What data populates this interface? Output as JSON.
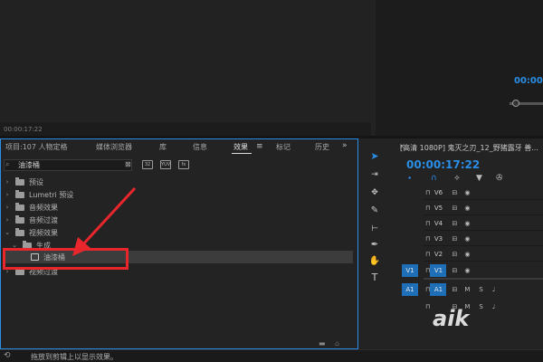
{
  "program_monitor": {
    "timecode": "00:00:17:22",
    "icons": [
      "export-frame-icon",
      "settings-icon"
    ]
  },
  "source_monitor": {
    "timecode": "00:00:"
  },
  "effects_panel": {
    "tabs": [
      {
        "label": "项目:107 人物定格",
        "active": false
      },
      {
        "label": "媒体浏览器",
        "active": false
      },
      {
        "label": "库",
        "active": false
      },
      {
        "label": "信息",
        "active": false
      },
      {
        "label": "效果",
        "active": true
      },
      {
        "label": "标记",
        "active": false
      },
      {
        "label": "历史",
        "active": false
      }
    ],
    "search_value": "油漆桶",
    "search_placeholder": "",
    "filter_buttons": [
      "32",
      "YUV",
      "fx"
    ],
    "tree": [
      {
        "label": "预设",
        "expanded": false,
        "type": "folder-special"
      },
      {
        "label": "Lumetri 预设",
        "expanded": false,
        "type": "folder-special"
      },
      {
        "label": "音频效果",
        "expanded": false,
        "type": "folder"
      },
      {
        "label": "音频过渡",
        "expanded": false,
        "type": "folder"
      },
      {
        "label": "视频效果",
        "expanded": true,
        "type": "folder"
      },
      {
        "label": "生成",
        "expanded": true,
        "type": "folder"
      },
      {
        "label": "油漆桶",
        "type": "effect",
        "selected": true
      },
      {
        "label": "视频过渡",
        "expanded": false,
        "type": "folder"
      }
    ]
  },
  "status_bar": {
    "text": "拖放到剪辑上以显示效果。"
  },
  "timeline": {
    "title": "[高清 1080P] 鬼灭之刃_12_野猪露牙 善...",
    "timecode": "00:00:17:22",
    "video_tracks": [
      "V6",
      "V5",
      "V4",
      "V3",
      "V2",
      "V1"
    ],
    "audio_tracks": [
      "A1"
    ],
    "source_patch_video": "V1",
    "source_patch_audio": "A1",
    "mute_label": "M",
    "solo_label": "S"
  },
  "watermark": "aik",
  "colors": {
    "accent": "#2b8ee6",
    "annotation": "#e8262c"
  }
}
